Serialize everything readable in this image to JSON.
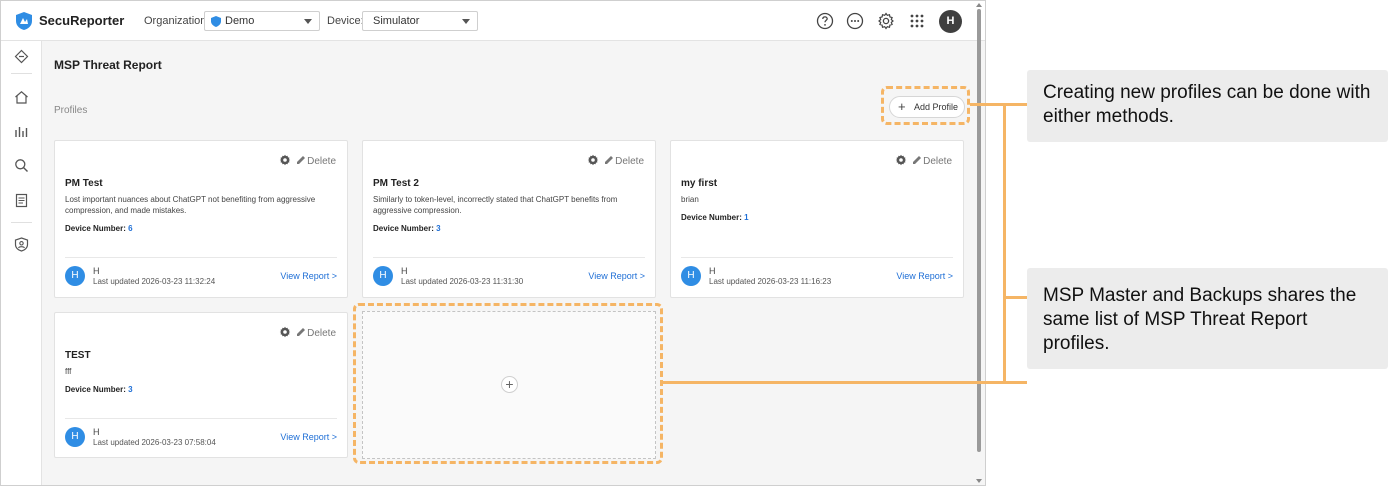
{
  "app": {
    "brand": "SecuReporter",
    "organization_label": "Organization:",
    "organization_value": "Demo",
    "device_label": "Device:",
    "device_value": "Simulator",
    "user_initial": "H"
  },
  "main": {
    "title": "MSP Threat Report",
    "section_label": "Profiles",
    "add_button_label": "Add Profile",
    "delete_label": "Delete",
    "device_number_label": "Device Number:",
    "view_report_label": "View Report >",
    "cards": [
      {
        "name": "PM Test",
        "description": "Lost important nuances about ChatGPT not benefiting from aggressive compression, and made mistakes.",
        "device_number": "6",
        "owner_initial": "H",
        "owner": "H",
        "last_updated": "Last updated 2026-03-23 11:32:24"
      },
      {
        "name": "PM Test 2",
        "description": "Similarly to token-level, incorrectly stated that ChatGPT benefits from aggressive compression.",
        "device_number": "3",
        "owner_initial": "H",
        "owner": "H",
        "last_updated": "Last updated 2026-03-23 11:31:30"
      },
      {
        "name": "my first",
        "description": "brian",
        "device_number": "1",
        "owner_initial": "H",
        "owner": "H",
        "last_updated": "Last updated 2026-03-23 11:16:23"
      },
      {
        "name": "TEST",
        "description": "fff",
        "device_number": "3",
        "owner_initial": "H",
        "owner": "H",
        "last_updated": "Last updated 2026-03-23 07:58:04"
      }
    ],
    "empty_card_icon": "+"
  },
  "annotations": {
    "callout_1": "Creating new profiles can be done with either methods.",
    "callout_2": "MSP Master and Backups shares the same list of MSP Threat Report profiles.",
    "highlight_color": "#f5b565"
  },
  "colors": {
    "accent": "#1f6fd6",
    "avatar_blue": "#2f8de4",
    "avatar_dark": "#3f3f3f"
  },
  "icons": {
    "topbar": [
      "help-icon",
      "more-icon",
      "settings-icon",
      "apps-grid-icon"
    ],
    "sidebar": [
      "collapse-icon",
      "home-icon",
      "chart-icon",
      "search-icon",
      "report-icon",
      "shield-user-icon"
    ]
  }
}
